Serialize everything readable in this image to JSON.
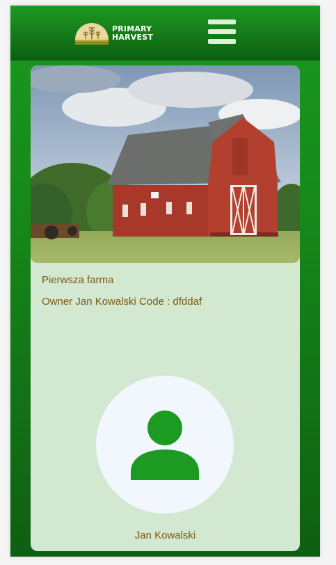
{
  "header": {
    "brand_line1": "PRIMARY",
    "brand_line2": "HARVEST",
    "logo_icon": "wheat-field-emblem-icon",
    "menu_icon": "hamburger-menu-icon"
  },
  "farm": {
    "name": "Pierwsza farma",
    "owner_line": "Owner Jan Kowalski Code : dfddaf",
    "photo_icon": "barn-photo"
  },
  "owner": {
    "avatar_icon": "user-avatar-icon",
    "name": "Jan Kowalski"
  },
  "colors": {
    "header_green": "#138a18",
    "card_bg": "#d2e8d1",
    "text_brown": "#7a5a12",
    "avatar_green": "#1c9a22"
  }
}
